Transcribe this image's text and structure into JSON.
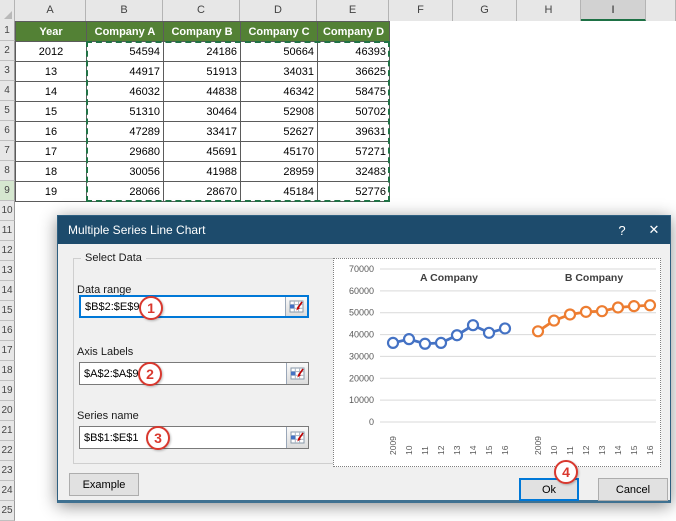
{
  "sheet": {
    "col_headers": [
      "A",
      "B",
      "C",
      "D",
      "E",
      "F",
      "G",
      "H",
      "I"
    ],
    "selected_col": "I",
    "selected_row": 9,
    "row_numbers_visible": 25,
    "table": {
      "header": [
        "Year",
        "Company A",
        "Company B",
        "Company C",
        "Company D"
      ],
      "rows": [
        [
          "2012",
          "54594",
          "24186",
          "50664",
          "46393"
        ],
        [
          "13",
          "44917",
          "51913",
          "34031",
          "36625"
        ],
        [
          "14",
          "46032",
          "44838",
          "46342",
          "58475"
        ],
        [
          "15",
          "51310",
          "30464",
          "52908",
          "50702"
        ],
        [
          "16",
          "47289",
          "33417",
          "52627",
          "39631"
        ],
        [
          "17",
          "29680",
          "45691",
          "45170",
          "57271"
        ],
        [
          "18",
          "30056",
          "41988",
          "28959",
          "32483"
        ],
        [
          "19",
          "28066",
          "28670",
          "45184",
          "52776"
        ]
      ],
      "selection_range": "B2:E9"
    }
  },
  "dialog": {
    "title": "Multiple Series Line Chart",
    "help_icon": "?",
    "close_icon": "✕",
    "group_label": "Select Data",
    "fields": [
      {
        "label": "Data range",
        "value": "$B$2:$E$9",
        "badge": "1",
        "focused": true
      },
      {
        "label": "Axis Labels",
        "value": "$A$2:$A$9",
        "badge": "2",
        "focused": false
      },
      {
        "label": "Series name",
        "value": "$B$1:$E$1",
        "badge": "3",
        "focused": false
      }
    ],
    "ok_badge": "4",
    "buttons": {
      "example": "Example",
      "ok": "Ok",
      "cancel": "Cancel"
    }
  },
  "chart_data": {
    "type": "line",
    "group_titles": [
      "A Company",
      "B Company"
    ],
    "x": [
      "2009",
      "10",
      "11",
      "12",
      "13",
      "14",
      "15",
      "16"
    ],
    "series": [
      {
        "name": "A Company",
        "color": "#4472C4",
        "values": [
          36200,
          37900,
          35800,
          36200,
          39700,
          44300,
          40800,
          42800
        ]
      },
      {
        "name": "B Company",
        "color": "#ED7D31",
        "values": [
          41500,
          46400,
          49200,
          50400,
          50700,
          52400,
          53000,
          53400
        ]
      }
    ],
    "ylim": [
      0,
      70000
    ],
    "ytick": 10000,
    "grid": true,
    "legend_position": "none"
  },
  "colors": {
    "title_bar": "#1D4B6C",
    "header_green": "#538135",
    "ants_green": "#217346",
    "focus_blue": "#0078D7",
    "badge_red": "#D9382E",
    "series_a": "#4472C4",
    "series_b": "#ED7D31"
  }
}
